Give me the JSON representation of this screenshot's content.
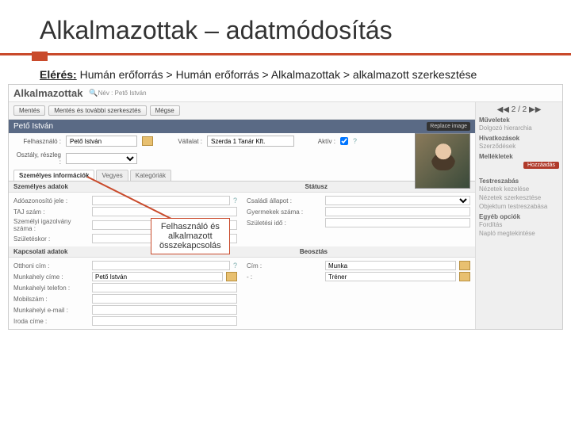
{
  "slide": {
    "title": "Alkalmazottak – adatmódosítás"
  },
  "path": {
    "label": "Elérés:",
    "value": "Humán erőforrás > Humán erőforrás > Alkalmazottak > alkalmazott szerkesztése"
  },
  "app": {
    "title": "Alkalmazottak",
    "crumb": "Név : Pető István",
    "toolbar": {
      "save": "Mentés",
      "save_edit": "Mentés és további szerkesztés",
      "cancel": "Mégse"
    },
    "name": "Pető István",
    "replace": "Replace image",
    "row1": {
      "user_lbl": "Felhasználó :",
      "user_val": "Pető István",
      "company_lbl": "Vállalat :",
      "company_val": "Szerda 1 Tanár Kft.",
      "active_lbl": "Aktív :"
    },
    "row2": {
      "dept_lbl": "Osztály, részleg :"
    },
    "tabs": [
      "Személyes információk",
      "Vegyes",
      "Kategóriák"
    ],
    "sec1": {
      "left": "Személyes adatok",
      "right": "Státusz"
    },
    "left_fields": {
      "tax": "Adóazonosító jele :",
      "ssn": "TAJ szám :",
      "idnum": "Személyi igazolvány száma :",
      "maiden": "Születéskor :"
    },
    "right_fields": {
      "marital": "Családi állapot :",
      "children": "Gyermekek száma :",
      "birthdate": "Születési idő :"
    },
    "sec2": {
      "left": "Kapcsolati adatok",
      "right": "Beosztás"
    },
    "left_fields2": {
      "home": "Otthoni cím :",
      "work_addr": "Munkahely címe :",
      "work_addr_val": "Pető István",
      "work_tel": "Munkahelyi telefon :",
      "mobile": "Mobilszám :",
      "work_email": "Munkahelyi e-mail :",
      "office": "Iroda címe :"
    },
    "right_fields2": {
      "job": "Cím :",
      "job_val": "Munka",
      "coach": "",
      "coach_val": "Tréner"
    }
  },
  "side": {
    "ops": "Műveletek",
    "ops1": "Dolgozó hierarchia",
    "links": "Hivatkozások",
    "links1": "Szerződések",
    "att": "Mellékletek",
    "add": "Hozzáadás",
    "test": "Testreszabás",
    "t1": "Nézetek kezelése",
    "t2": "Nézetek szerkesztése",
    "t3": "Objektum testreszabása",
    "other": "Egyéb opciók",
    "o1": "Fordítás",
    "o2": "Napló megtekintése",
    "pager": "◀◀  2 / 2  ▶▶"
  },
  "callout": {
    "text1": "Felhasználó és",
    "text2": "alkalmazott",
    "text3": "összekapcsolás"
  }
}
